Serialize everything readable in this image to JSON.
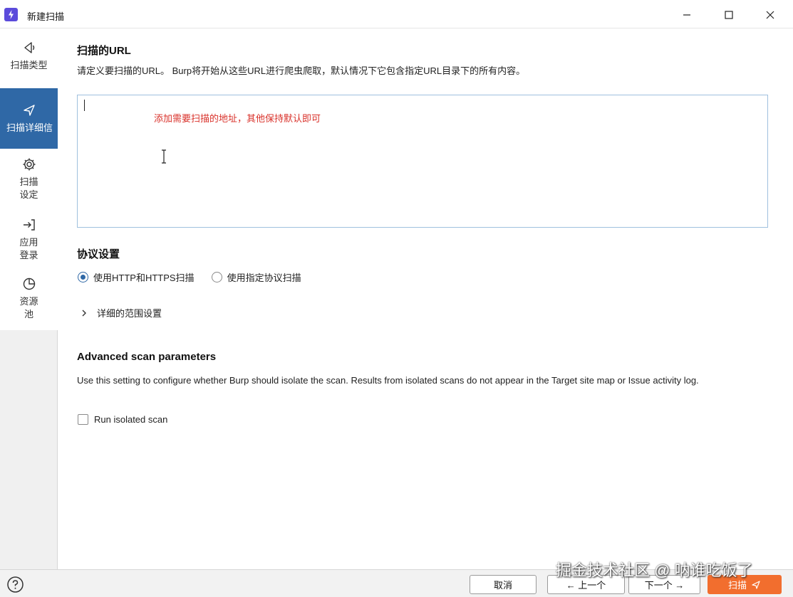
{
  "window": {
    "title": "新建扫描",
    "minimize_label": "minimize",
    "maximize_label": "maximize",
    "close_label": "close"
  },
  "sidebar": {
    "items": [
      {
        "label": "扫描类型",
        "icon": "scan-type-icon"
      },
      {
        "label": "扫描详细信",
        "icon": "scan-details-icon"
      },
      {
        "label": "扫描\n设定",
        "icon": "gear-icon"
      },
      {
        "label": "应用\n登录",
        "icon": "login-icon"
      },
      {
        "label": "资源\n池",
        "icon": "resource-pool-icon"
      }
    ],
    "active_index": 1
  },
  "url_section": {
    "title": "扫描的URL",
    "description": "请定义要扫描的URL。 Burp将开始从这些URL进行爬虫爬取，默认情况下它包含指定URL目录下的所有内容。",
    "urls_value": "",
    "annotation": "添加需要扫描的地址，其他保持默认即可"
  },
  "protocol_section": {
    "title": "协议设置",
    "options": [
      "使用HTTP和HTTPS扫描",
      "使用指定协议扫描"
    ],
    "selected_index": 0,
    "scope_expander": "详细的范围设置"
  },
  "advanced_section": {
    "title": "Advanced scan parameters",
    "description": "Use this setting to configure whether Burp should isolate the scan. Results from isolated scans do not appear in the Target site map or Issue activity log.",
    "isolated_label": "Run isolated scan",
    "isolated_checked": false
  },
  "footer": {
    "cancel_label": "取消",
    "prev_label": "← 上一个",
    "next_label": "下一个 →",
    "scan_label": "扫描",
    "watermark": "掘金技术社区 @ 呐谁吃饭了"
  },
  "colors": {
    "accent": "#2f68a6",
    "scan_button": "#f26e2e",
    "annotation": "#d9312a",
    "app_icon": "#5b4bdb"
  }
}
